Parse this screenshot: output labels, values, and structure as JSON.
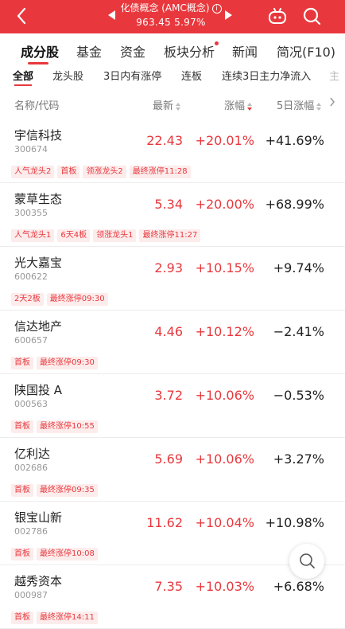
{
  "header": {
    "title": "化债概念 (AMC概念)",
    "subtitle": "963.45 5.97%",
    "info_icon": "i",
    "bg_color": "#e8383d"
  },
  "tabs": [
    "成分股",
    "基金",
    "资金",
    "板块分析",
    "新闻",
    "简况(F10)"
  ],
  "subtabs": [
    "全部",
    "龙头股",
    "3日内有涨停",
    "连板",
    "连续3日主力净流入",
    "主"
  ],
  "columns": {
    "name": "名称/代码",
    "price": "最新",
    "change": "涨幅",
    "change5": "5日涨幅"
  },
  "stocks": [
    {
      "name": "宇信科技",
      "code": "300674",
      "price": "22.43",
      "change": "+20.01%",
      "change5": "+41.69%",
      "tags": [
        "人气龙头2",
        "首板",
        "领涨龙头2",
        "最终涨停11:28"
      ]
    },
    {
      "name": "蒙草生态",
      "code": "300355",
      "price": "5.34",
      "change": "+20.00%",
      "change5": "+68.99%",
      "tags": [
        "人气龙头1",
        "6天4板",
        "领涨龙头1",
        "最终涨停11:27"
      ]
    },
    {
      "name": "光大嘉宝",
      "code": "600622",
      "price": "2.93",
      "change": "+10.15%",
      "change5": "+9.74%",
      "tags": [
        "2天2板",
        "最终涨停09:30"
      ]
    },
    {
      "name": "信达地产",
      "code": "600657",
      "price": "4.46",
      "change": "+10.12%",
      "change5": "−2.41%",
      "tags": [
        "首板",
        "最终涨停09:30"
      ]
    },
    {
      "name": "陕国投 A",
      "code": "000563",
      "price": "3.72",
      "change": "+10.06%",
      "change5": "−0.53%",
      "tags": [
        "首板",
        "最终涨停10:55"
      ]
    },
    {
      "name": "亿利达",
      "code": "002686",
      "price": "5.69",
      "change": "+10.06%",
      "change5": "+3.27%",
      "tags": [
        "首板",
        "最终涨停09:35"
      ]
    },
    {
      "name": "银宝山新",
      "code": "002786",
      "price": "11.62",
      "change": "+10.04%",
      "change5": "+10.98%",
      "tags": [
        "首板",
        "最终涨停10:08"
      ]
    },
    {
      "name": "越秀资本",
      "code": "000987",
      "price": "7.35",
      "change": "+10.03%",
      "change5": "+6.68%",
      "tags": [
        "首板",
        "最终涨停14:11"
      ]
    }
  ]
}
